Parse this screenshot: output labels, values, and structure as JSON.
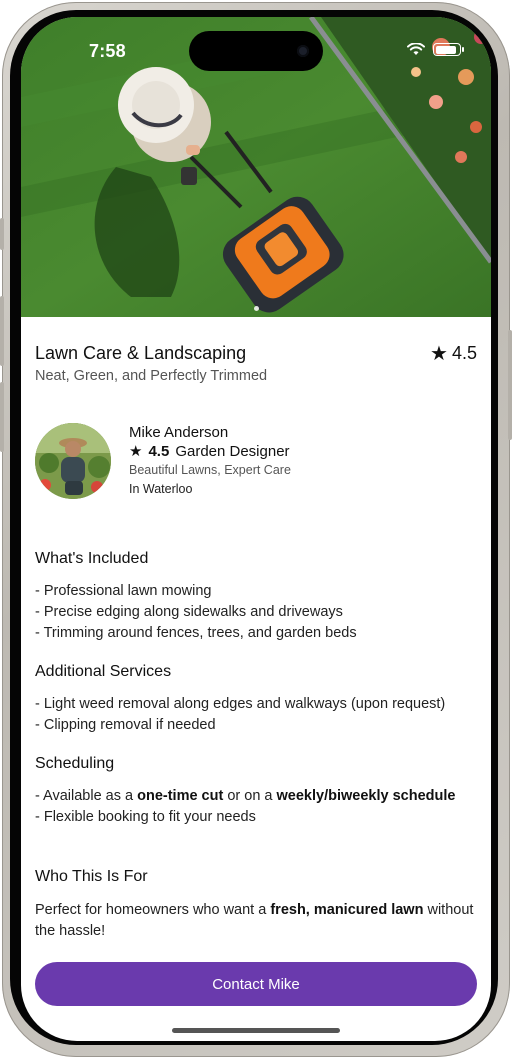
{
  "status_bar": {
    "time": "7:58"
  },
  "listing": {
    "title": "Lawn Care & Landscaping",
    "subtitle": "Neat, Green, and Perfectly Trimmed",
    "rating": "4.5"
  },
  "provider": {
    "name": "Mike Anderson",
    "rating": "4.5",
    "role": "Garden Designer",
    "tagline": "Beautiful Lawns, Expert Care",
    "location": "In Waterloo"
  },
  "sections": {
    "included": {
      "heading": "What's Included",
      "lines": [
        "- Professional lawn mowing",
        "- Precise edging along sidewalks and driveways",
        "- Trimming around fences, trees, and garden beds"
      ]
    },
    "additional": {
      "heading": "Additional Services",
      "lines": [
        "- Light weed removal along edges and walkways (upon request)",
        "- Clipping removal if needed"
      ]
    },
    "scheduling": {
      "heading": "Scheduling",
      "line1_a": "- Available as a ",
      "line1_b": "one-time cut",
      "line1_c": " or on a ",
      "line1_d": "weekly/biweekly schedule",
      "line2": "- Flexible booking to fit your needs"
    },
    "audience": {
      "heading": "Who This Is For",
      "text_a": "Perfect for homeowners who want a ",
      "text_b": "fresh, manicured lawn",
      "text_c": " without the hassle!"
    }
  },
  "cta": {
    "label": "Contact Mike"
  },
  "colors": {
    "accent": "#6a3aad",
    "lawn": "#3e7a2a"
  },
  "icons": [
    "wifi-icon",
    "battery-icon",
    "star-icon"
  ]
}
